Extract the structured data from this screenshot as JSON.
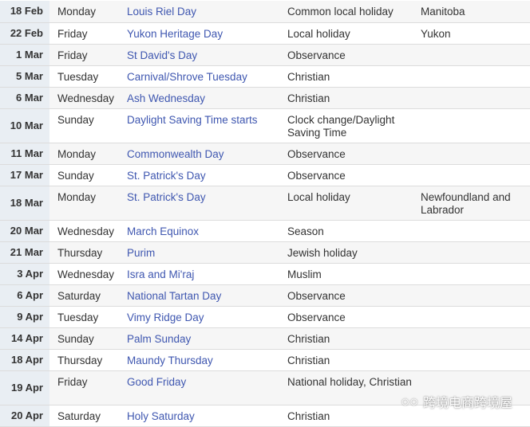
{
  "rows": [
    {
      "date": "18 Feb",
      "day": "Monday",
      "name": "Louis Riel Day",
      "type": "Common local holiday",
      "region": "Manitoba"
    },
    {
      "date": "22 Feb",
      "day": "Friday",
      "name": "Yukon Heritage Day",
      "type": "Local holiday",
      "region": "Yukon"
    },
    {
      "date": "1 Mar",
      "day": "Friday",
      "name": "St David's Day",
      "type": "Observance",
      "region": ""
    },
    {
      "date": "5 Mar",
      "day": "Tuesday",
      "name": "Carnival/Shrove Tuesday",
      "type": "Christian",
      "region": ""
    },
    {
      "date": "6 Mar",
      "day": "Wednesday",
      "name": "Ash Wednesday",
      "type": "Christian",
      "region": ""
    },
    {
      "date": "10 Mar",
      "day": "Sunday",
      "name": "Daylight Saving Time starts",
      "type": "Clock change/Daylight Saving Time",
      "region": "",
      "tall": true
    },
    {
      "date": "11 Mar",
      "day": "Monday",
      "name": "Commonwealth Day",
      "type": "Observance",
      "region": ""
    },
    {
      "date": "17 Mar",
      "day": "Sunday",
      "name": "St. Patrick's Day",
      "type": "Observance",
      "region": ""
    },
    {
      "date": "18 Mar",
      "day": "Monday",
      "name": "St. Patrick's Day",
      "type": "Local holiday",
      "region": "Newfoundland and Labrador",
      "tall": true
    },
    {
      "date": "20 Mar",
      "day": "Wednesday",
      "name": "March Equinox",
      "type": "Season",
      "region": ""
    },
    {
      "date": "21 Mar",
      "day": "Thursday",
      "name": "Purim",
      "type": "Jewish holiday",
      "region": ""
    },
    {
      "date": "3 Apr",
      "day": "Wednesday",
      "name": "Isra and Mi'raj",
      "type": "Muslim",
      "region": ""
    },
    {
      "date": "6 Apr",
      "day": "Saturday",
      "name": "National Tartan Day",
      "type": "Observance",
      "region": ""
    },
    {
      "date": "9 Apr",
      "day": "Tuesday",
      "name": "Vimy Ridge Day",
      "type": "Observance",
      "region": ""
    },
    {
      "date": "14 Apr",
      "day": "Sunday",
      "name": "Palm Sunday",
      "type": "Christian",
      "region": ""
    },
    {
      "date": "18 Apr",
      "day": "Thursday",
      "name": "Maundy Thursday",
      "type": "Christian",
      "region": ""
    },
    {
      "date": "19 Apr",
      "day": "Friday",
      "name": "Good Friday",
      "type": "National holiday, Christian",
      "region": "",
      "tall": true
    },
    {
      "date": "20 Apr",
      "day": "Saturday",
      "name": "Holy Saturday",
      "type": "Christian",
      "region": ""
    }
  ],
  "watermark": {
    "text": "跨境电商跨境屋",
    "icon": "wechat-icon"
  },
  "colors": {
    "link": "#3f57b0",
    "date_bg": "#e9eef3"
  }
}
